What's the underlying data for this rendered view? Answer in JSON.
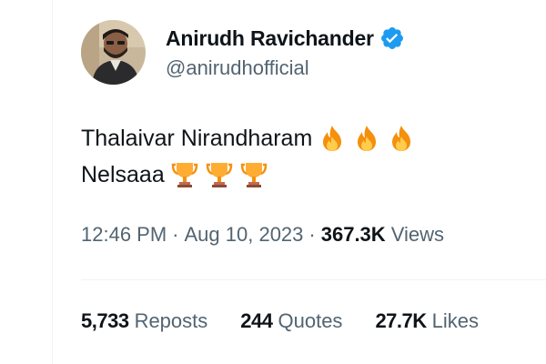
{
  "author": {
    "name": "Anirudh Ravichander",
    "handle": "@anirudhofficial",
    "verified": true
  },
  "tweet": {
    "lines": [
      {
        "text": "Thalaivar Nirandharam",
        "emoji": "fire-icon",
        "emoji_count": 3
      },
      {
        "text": "Nelsaaa",
        "emoji": "trophy-icon",
        "emoji_count": 3
      }
    ]
  },
  "meta": {
    "time": "12:46 PM",
    "separator": "·",
    "date": "Aug 10, 2023",
    "views_count": "367.3K",
    "views_label": "Views"
  },
  "stats": [
    {
      "count": "5,733",
      "label": "Reposts"
    },
    {
      "count": "244",
      "label": "Quotes"
    },
    {
      "count": "27.7K",
      "label": "Likes"
    }
  ],
  "colors": {
    "text_primary": "#0f1419",
    "text_secondary": "#536471",
    "verified_blue": "#1d9bf0",
    "divider": "#eff3f4"
  }
}
